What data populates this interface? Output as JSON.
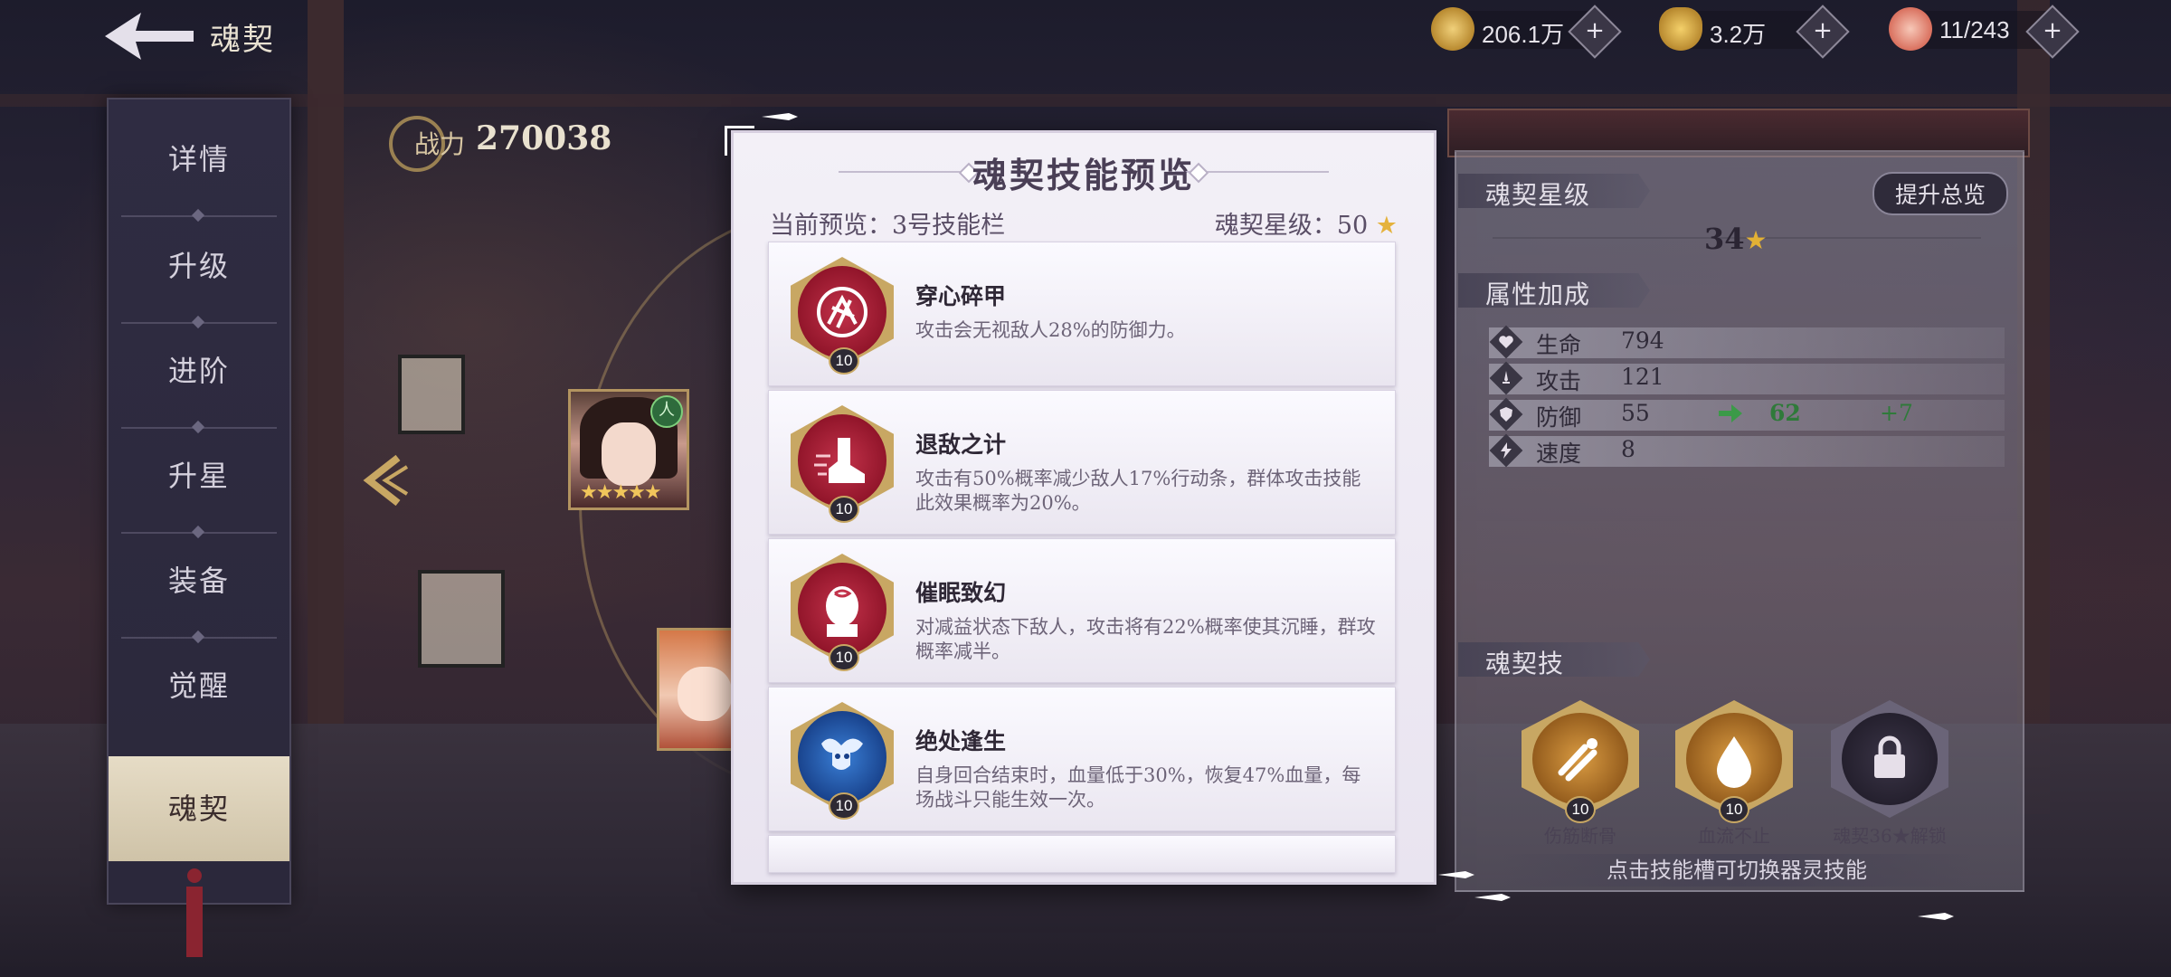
{
  "header": {
    "title": "魂契"
  },
  "resources": [
    {
      "name": "gold",
      "value": "206.1万",
      "color": "#c9a24a"
    },
    {
      "name": "ingot",
      "value": "3.2万",
      "color": "#d9b04e"
    },
    {
      "name": "peach",
      "value": "11/243",
      "color": "#e49a8a"
    }
  ],
  "sidebar": {
    "items": [
      {
        "label": "详情"
      },
      {
        "label": "升级"
      },
      {
        "label": "进阶"
      },
      {
        "label": "升星"
      },
      {
        "label": "装备"
      },
      {
        "label": "觉醒"
      },
      {
        "label": "魂契",
        "active": true
      }
    ]
  },
  "power": {
    "label": "战力",
    "value": "270038"
  },
  "character": {
    "badge": "人",
    "stars": "★★★★★"
  },
  "modal": {
    "title": "魂契技能预览",
    "preview_label": "当前预览：3号技能栏",
    "star_level_label": "魂契星级：50",
    "star_icon": "★",
    "skills": [
      {
        "name": "穿心碎甲",
        "desc": "攻击会无视敌人28%的防御力。",
        "level": "10",
        "color": "#9b1832",
        "icon": "rose-icon"
      },
      {
        "name": "退敌之计",
        "desc": "攻击有50%概率减少敌人17%行动条，群体攻击技能此效果概率为20%。",
        "level": "10",
        "color": "#9b1832",
        "icon": "boot-icon"
      },
      {
        "name": "催眠致幻",
        "desc": "对减益状态下敌人，攻击将有22%概率使其沉睡，群攻概率减半。",
        "level": "10",
        "color": "#9b1832",
        "icon": "monk-icon"
      },
      {
        "name": "绝处逢生",
        "desc": "自身回合结束时，血量低于30%，恢复47%血量，每场战斗只能生效一次。",
        "level": "10",
        "color": "#1e5db0",
        "icon": "spirit-icon"
      }
    ]
  },
  "right_panel": {
    "star_section": "魂契星级",
    "upgrade_button": "提升总览",
    "star_count": "34",
    "attr_section": "属性加成",
    "attrs": [
      {
        "name": "生命",
        "value": "794",
        "icon": "heart-icon"
      },
      {
        "name": "攻击",
        "value": "121",
        "icon": "sword-icon"
      },
      {
        "name": "防御",
        "value": "55",
        "new_value": "62",
        "delta": "+7",
        "icon": "shield-icon"
      },
      {
        "name": "速度",
        "value": "8",
        "icon": "lightning-icon"
      }
    ],
    "skill_section": "魂契技",
    "soul_skills": [
      {
        "caption": "伤筋断骨",
        "level": "10",
        "icon": "bone-break-icon"
      },
      {
        "caption": "血流不止",
        "level": "10",
        "icon": "blood-drop-icon"
      },
      {
        "caption": "魂契36★解锁",
        "icon": "lock-icon"
      }
    ],
    "hint": "点击技能槽可切换器灵技能"
  }
}
